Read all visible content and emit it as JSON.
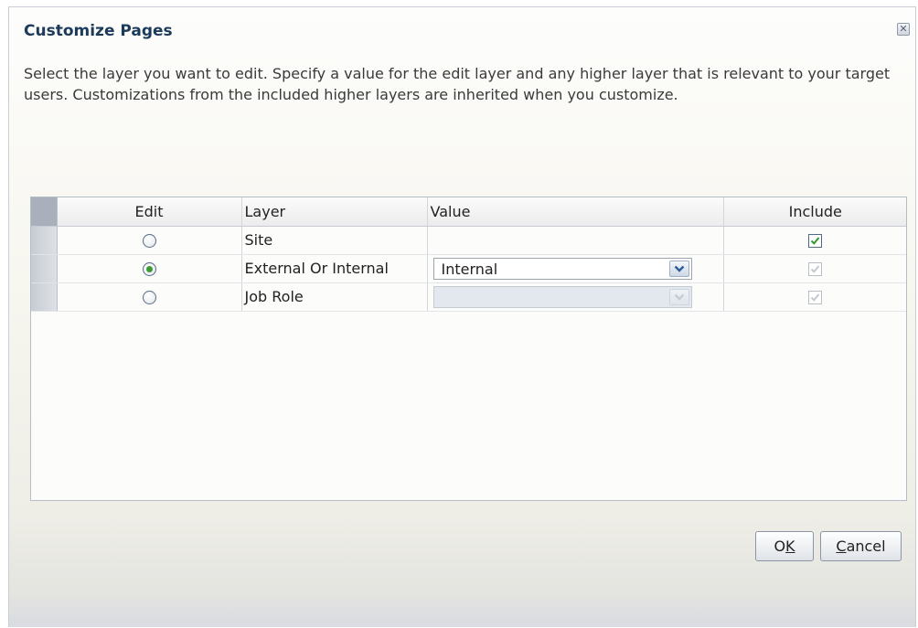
{
  "dialog": {
    "title": "Customize Pages",
    "close_glyph": "✕",
    "instructions": "Select the layer you want to edit. Specify a value for the edit layer and any higher layer that is relevant to your target users. Customizations from the included higher layers are inherited when you customize."
  },
  "table": {
    "headers": {
      "edit": "Edit",
      "layer": "Layer",
      "value": "Value",
      "include": "Include"
    },
    "rows": [
      {
        "layer": "Site",
        "edit_selected": false,
        "has_value": false,
        "value": "",
        "value_enabled": false,
        "include": true,
        "include_enabled": true
      },
      {
        "layer": "External Or Internal",
        "edit_selected": true,
        "has_value": true,
        "value": "Internal",
        "value_enabled": true,
        "include": true,
        "include_enabled": false
      },
      {
        "layer": "Job Role",
        "edit_selected": false,
        "has_value": true,
        "value": "",
        "value_enabled": false,
        "include": true,
        "include_enabled": false
      }
    ]
  },
  "buttons": {
    "ok": {
      "mnemonic_pre": "O",
      "mnemonic": "K",
      "mnemonic_post": ""
    },
    "cancel": {
      "mnemonic_pre": "",
      "mnemonic": "C",
      "mnemonic_post": "ancel"
    }
  },
  "colors": {
    "title": "#1c3a5a",
    "check_enabled": "#2f9a2a",
    "check_disabled": "#c2c8cf",
    "radio_dot": "#3e9b32"
  },
  "icons": {
    "close": "close-icon",
    "dropdown": "chevron-down-icon",
    "check": "check-icon"
  }
}
